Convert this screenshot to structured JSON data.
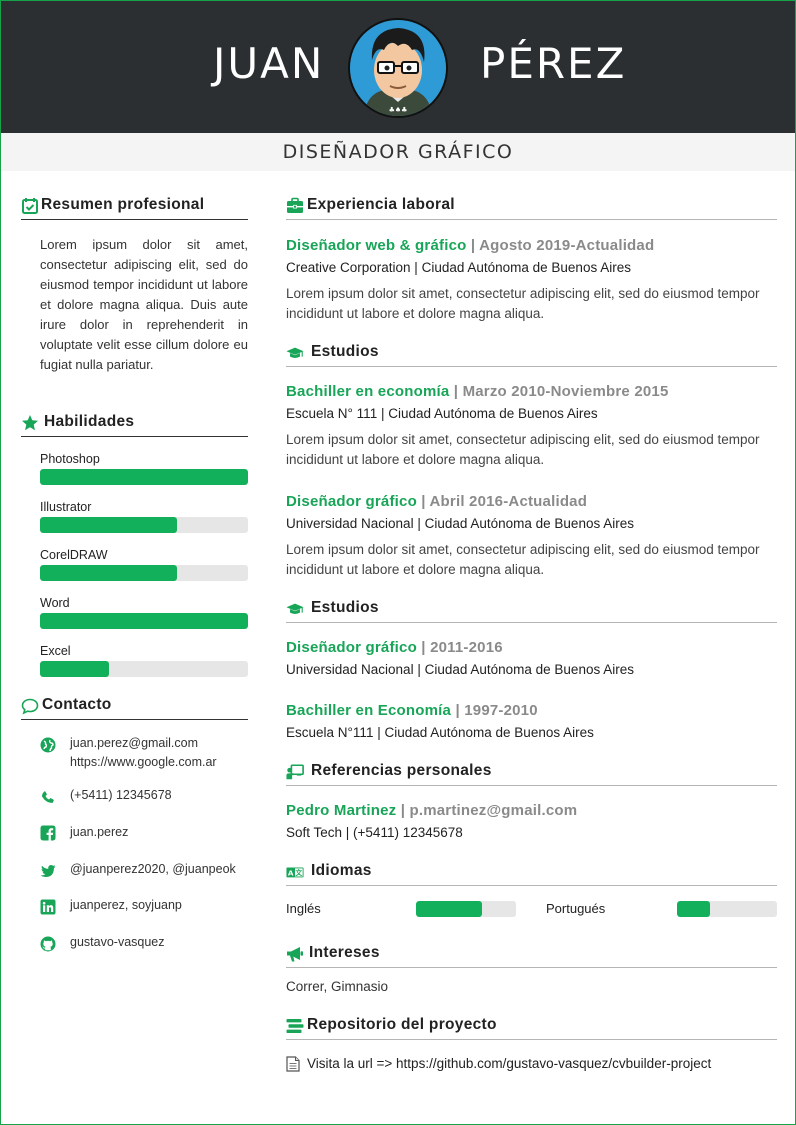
{
  "header": {
    "first_name": "JUAN",
    "last_name": "PÉREZ",
    "subtitle": "DISEÑADOR GRÁFICO"
  },
  "colors": {
    "accent": "#18a558",
    "bar_fill": "#12b05a",
    "header_bg": "#2b2f31"
  },
  "left": {
    "summary": {
      "icon": "calendar-check-icon",
      "title": "Resumen profesional",
      "text": "Lorem ipsum dolor sit amet, consectetur adipiscing elit, sed do eiusmod tempor incididunt ut labore et dolore magna aliqua. Duis aute irure dolor in reprehenderit in voluptate velit esse cillum dolore eu fugiat nulla pariatur."
    },
    "skills": {
      "icon": "star-icon",
      "title": "Habilidades",
      "items": [
        {
          "name": "Photoshop",
          "level": 1.0
        },
        {
          "name": "Illustrator",
          "level": 0.66
        },
        {
          "name": "CorelDRAW",
          "level": 0.66
        },
        {
          "name": "Word",
          "level": 1.0
        },
        {
          "name": "Excel",
          "level": 0.33
        }
      ]
    },
    "contact": {
      "icon": "comment-icon",
      "title": "Contacto",
      "items": [
        {
          "icon": "globe-icon",
          "lines": [
            "juan.perez@gmail.com",
            "https://www.google.com.ar"
          ]
        },
        {
          "icon": "phone-icon",
          "lines": [
            "(+5411) 12345678"
          ]
        },
        {
          "icon": "facebook-icon",
          "lines": [
            "juan.perez"
          ]
        },
        {
          "icon": "twitter-icon",
          "lines": [
            "@juanperez2020, @juanpeok"
          ]
        },
        {
          "icon": "linkedin-icon",
          "lines": [
            "juanperez, soyjuanp"
          ]
        },
        {
          "icon": "github-icon",
          "lines": [
            "gustavo-vasquez"
          ]
        }
      ]
    }
  },
  "right": {
    "experience": {
      "icon": "briefcase-icon",
      "title": "Experiencia laboral",
      "entries": [
        {
          "title": "Diseñador web & gráfico",
          "date": "Agosto 2019-Actualidad",
          "place": "Creative Corporation | Ciudad Autónoma de Buenos Aires",
          "desc": "Lorem ipsum dolor sit amet, consectetur adipiscing elit, sed do eiusmod tempor incididunt ut labore et dolore magna aliqua."
        }
      ]
    },
    "studies1": {
      "icon": "graduation-cap-icon",
      "title": "Estudios",
      "entries": [
        {
          "title": "Bachiller en economía",
          "date": "Marzo 2010-Noviembre 2015",
          "place": "Escuela N° 111 | Ciudad Autónoma de Buenos Aires",
          "desc": "Lorem ipsum dolor sit amet, consectetur adipiscing elit, sed do eiusmod tempor incididunt ut labore et dolore magna aliqua."
        },
        {
          "title": "Diseñador gráfico",
          "date": "Abril 2016-Actualidad",
          "place": "Universidad Nacional | Ciudad Autónoma de Buenos Aires",
          "desc": "Lorem ipsum dolor sit amet, consectetur adipiscing elit, sed do eiusmod tempor incididunt ut labore et dolore magna aliqua."
        }
      ]
    },
    "studies2": {
      "icon": "graduation-cap-icon",
      "title": "Estudios",
      "entries": [
        {
          "title": "Diseñador gráfico",
          "date": "2011-2016",
          "place": "Universidad Nacional | Ciudad Autónoma de Buenos Aires"
        },
        {
          "title": "Bachiller en Economía",
          "date": "1997-2010",
          "place": "Escuela N°111 | Ciudad Autónoma de Buenos Aires"
        }
      ]
    },
    "references": {
      "icon": "chalkboard-teacher-icon",
      "title": "Referencias personales",
      "entries": [
        {
          "name": "Pedro Martinez",
          "email": "p.martinez@gmail.com",
          "details": "Soft Tech | (+5411) 12345678"
        }
      ]
    },
    "languages": {
      "icon": "language-icon",
      "title": "Idiomas",
      "items": [
        {
          "name": "Inglés",
          "level": 0.66
        },
        {
          "name": "Portugués",
          "level": 0.33
        }
      ]
    },
    "interests": {
      "icon": "bullhorn-icon",
      "title": "Intereses",
      "text": "Correr, Gimnasio"
    },
    "repository": {
      "icon": "stream-icon",
      "title": "Repositorio del proyecto",
      "doc_icon": "document-icon",
      "text": "Visita la url => https://github.com/gustavo-vasquez/cvbuilder-project"
    }
  }
}
